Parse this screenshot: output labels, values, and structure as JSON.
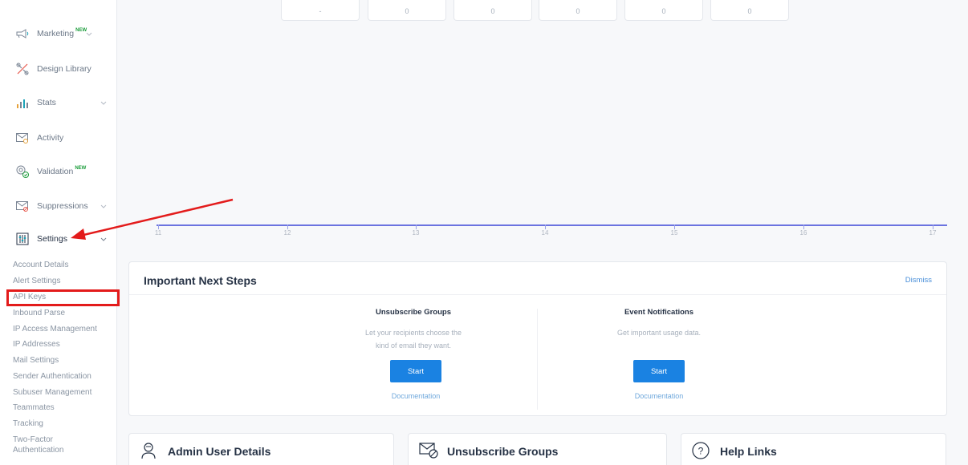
{
  "sidebar": {
    "nav_items": [
      {
        "label": "Marketing",
        "badge": "NEW",
        "icon": "megaphone-icon"
      },
      {
        "label": "Design Library",
        "icon": "design-icon"
      },
      {
        "label": "Stats",
        "icon": "stats-icon"
      },
      {
        "label": "Activity",
        "icon": "activity-icon"
      },
      {
        "label": "Validation",
        "badge": "NEW",
        "icon": "validation-icon"
      },
      {
        "label": "Suppressions",
        "icon": "suppressions-icon"
      },
      {
        "label": "Settings",
        "icon": "settings-icon"
      }
    ],
    "settings_subitems": [
      "Account Details",
      "Alert Settings",
      "API Keys",
      "Inbound Parse",
      "IP Access Management",
      "IP Addresses",
      "Mail Settings",
      "Sender Authentication",
      "Subuser Management",
      "Teammates",
      "Tracking",
      "Two-Factor",
      "Authentication"
    ]
  },
  "stats": {
    "boxes": [
      "-",
      "0",
      "0",
      "0",
      "0",
      "0"
    ],
    "x_ticks": [
      "11",
      "12",
      "13",
      "14",
      "15",
      "16",
      "17"
    ]
  },
  "next_steps": {
    "title": "Important Next Steps",
    "dismiss": "Dismiss",
    "items": [
      {
        "heading": "Unsubscribe Groups",
        "desc1": "Let your recipients choose the",
        "desc2": "kind of email they want.",
        "button": "Start",
        "link": "Documentation"
      },
      {
        "heading": "Event Notifications",
        "desc1": "Get important usage data.",
        "desc2": "",
        "button": "Start",
        "link": "Documentation"
      }
    ]
  },
  "bottom_cards": [
    {
      "title": "Admin User Details",
      "icon": "user-icon"
    },
    {
      "title": "Unsubscribe Groups",
      "icon": "unsubscribe-mail-icon"
    },
    {
      "title": "Help Links",
      "icon": "help-icon"
    }
  ],
  "colors": {
    "accent": "#1a82e2",
    "annotation_red": "#e31b1b",
    "chart_line": "#6b73e0",
    "new_badge": "#1a9c3a"
  }
}
